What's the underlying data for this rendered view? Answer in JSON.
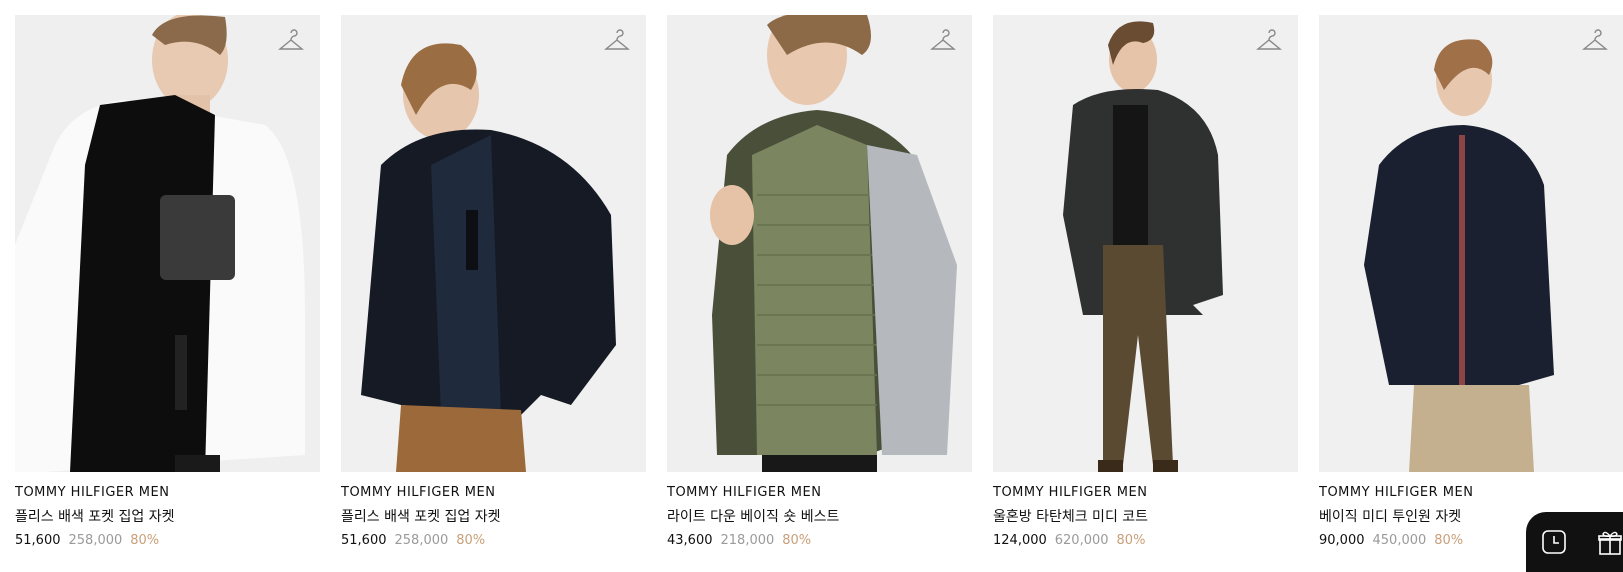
{
  "products": [
    {
      "brand": "TOMMY HILFIGER MEN",
      "name": "플리스 배색 포켓 집업 자켓",
      "price": "51,600",
      "original_price": "258,000",
      "discount": "80%",
      "image": "model-white-fleece-zip-jacket"
    },
    {
      "brand": "TOMMY HILFIGER MEN",
      "name": "플리스 배색 포켓 집업 자켓",
      "price": "51,600",
      "original_price": "258,000",
      "discount": "80%",
      "image": "model-navy-fleece-zip-jacket"
    },
    {
      "brand": "TOMMY HILFIGER MEN",
      "name": "라이트 다운 베이직 숏 베스트",
      "price": "43,600",
      "original_price": "218,000",
      "discount": "80%",
      "image": "model-khaki-down-vest"
    },
    {
      "brand": "TOMMY HILFIGER MEN",
      "name": "울혼방 타탄체크 미디 코트",
      "price": "124,000",
      "original_price": "620,000",
      "discount": "80%",
      "image": "model-dark-check-midi-coat"
    },
    {
      "brand": "TOMMY HILFIGER MEN",
      "name": "베이직 미디 투인원 자켓",
      "price": "90,000",
      "original_price": "450,000",
      "discount": "80%",
      "image": "model-navy-two-in-one-jacket"
    }
  ],
  "icons": {
    "wishlist": "hanger-icon",
    "recent": "clock-icon",
    "gift": "gift-icon"
  },
  "colors": {
    "discount": "#c8a07a",
    "original_price": "#9a9a9a",
    "dock": "#111111"
  }
}
